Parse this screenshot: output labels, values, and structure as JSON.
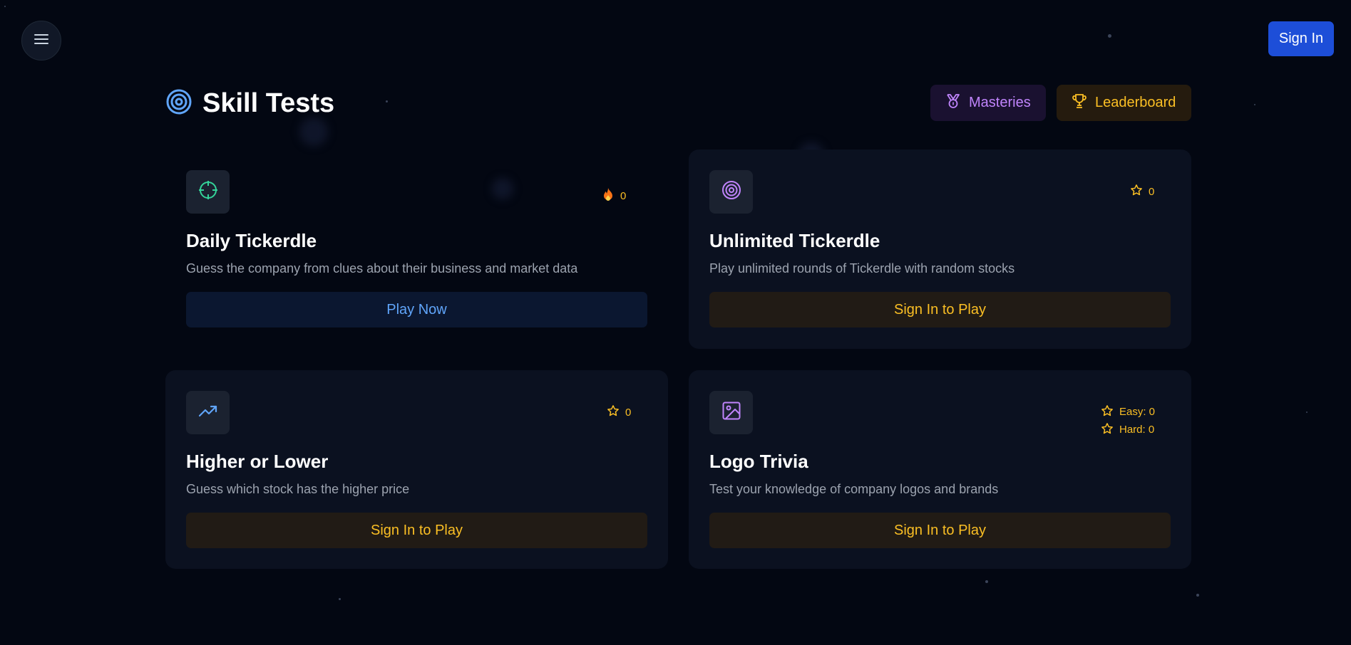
{
  "app": {
    "sign_in_label": "Sign In",
    "page_title": "Skill Tests"
  },
  "header": {
    "masteries_label": "Masteries",
    "leaderboard_label": "Leaderboard"
  },
  "cards": [
    {
      "title": "Daily Tickerdle",
      "description": "Guess the company from clues about their business and market data",
      "button_label": "Play Now",
      "icon": "crosshair-icon",
      "stat_icon": "flame-icon",
      "stat_value": "0"
    },
    {
      "title": "Unlimited Tickerdle",
      "description": "Play unlimited rounds of Tickerdle with random stocks",
      "button_label": "Sign In to Play",
      "icon": "target-icon",
      "stat_icon": "star-icon",
      "stat_value": "0"
    },
    {
      "title": "Higher or Lower",
      "description": "Guess which stock has the higher price",
      "button_label": "Sign In to Play",
      "icon": "trending-up-icon",
      "stat_icon": "star-icon",
      "stat_value": "0"
    },
    {
      "title": "Logo Trivia",
      "description": "Test your knowledge of company logos and brands",
      "button_label": "Sign In to Play",
      "icon": "image-icon",
      "stat_icon": "star-icon",
      "stats": [
        "Easy: 0",
        "Hard: 0"
      ]
    }
  ],
  "colors": {
    "background": "#030712",
    "card": "#0b1120",
    "primary_blue": "#1d4ed8",
    "accent_blue": "#60a5fa",
    "accent_amber": "#fbbf24",
    "accent_purple": "#c084fc",
    "accent_green": "#34d399",
    "muted_text": "#9ca3af"
  }
}
